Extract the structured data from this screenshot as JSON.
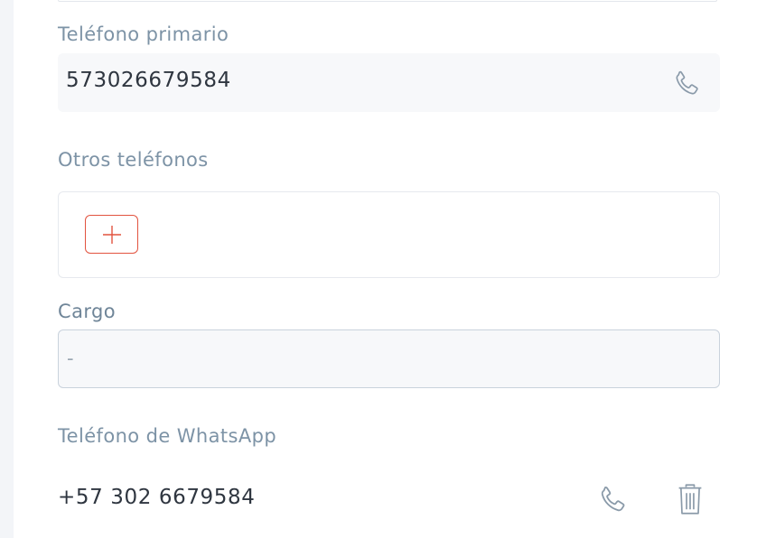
{
  "primary_phone": {
    "label": "Teléfono primario",
    "value": "573026679584",
    "call_icon": "phone-icon"
  },
  "other_phones": {
    "label": "Otros teléfonos",
    "add_icon": "plus-icon"
  },
  "cargo": {
    "label": "Cargo",
    "value": "-"
  },
  "whatsapp": {
    "label": "Teléfono de WhatsApp",
    "value": "+57 302 6679584",
    "call_icon": "phone-icon",
    "delete_icon": "trash-icon"
  },
  "colors": {
    "accent": "#e2533f",
    "label": "#7d93a6",
    "value_text": "#2f3640",
    "icon": "#8a9aa9",
    "field_bg": "#f7f8fa"
  }
}
